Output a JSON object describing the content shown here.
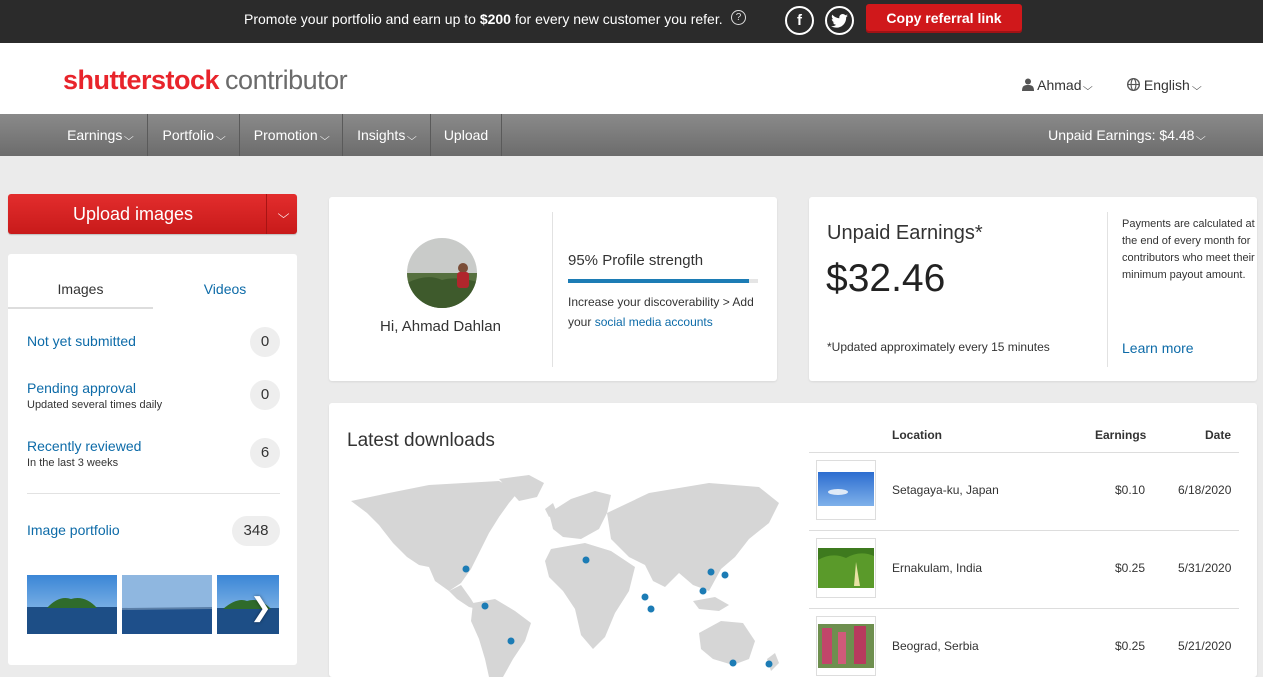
{
  "promo": {
    "text_before": "Promote your portfolio and earn up to ",
    "amount": "$200",
    "text_after": " for every new customer you refer.",
    "help_icon": "?",
    "facebook_icon": "f",
    "twitter_icon": "t",
    "cta": "Copy referral link",
    "cta_color": "#d0181b"
  },
  "header": {
    "logo_brand": "shutterstock",
    "logo_sub": "contributor",
    "user": "Ahmad",
    "language": "English"
  },
  "nav": {
    "items": [
      "Earnings",
      "Portfolio",
      "Promotion",
      "Insights",
      "Upload"
    ],
    "unpaid": "Unpaid Earnings: $4.48"
  },
  "upload_button": "Upload images",
  "tabs": {
    "images": "Images",
    "videos": "Videos"
  },
  "stats": [
    {
      "label": "Not yet submitted",
      "sub": "",
      "count": "0"
    },
    {
      "label": "Pending approval",
      "sub": "Updated several times daily",
      "count": "0"
    },
    {
      "label": "Recently reviewed",
      "sub": "In the last 3 weeks",
      "count": "6"
    }
  ],
  "portfolio": {
    "label": "Image portfolio",
    "count": "348"
  },
  "profile": {
    "greeting": "Hi, Ahmad Dahlan",
    "strength_label": "95% Profile strength",
    "strength_value": 0.95,
    "discover_text": "Increase your discoverability > Add your ",
    "discover_link": "social media accounts"
  },
  "earnings": {
    "title": "Unpaid Earnings*",
    "amount": "$32.46",
    "note": "*Updated approximately every 15 minutes",
    "info": "Payments are calculated at the end of every month for contributors who meet their minimum payout amount.",
    "learn_more": "Learn more"
  },
  "downloads": {
    "title": "Latest downloads",
    "columns": {
      "location": "Location",
      "earnings": "Earnings",
      "date": "Date"
    },
    "rows": [
      {
        "location": "Setagaya-ku, Japan",
        "earnings": "$0.10",
        "date": "6/18/2020"
      },
      {
        "location": "Ernakulam, India",
        "earnings": "$0.25",
        "date": "5/31/2020"
      },
      {
        "location": "Beograd, Serbia",
        "earnings": "$0.25",
        "date": "5/21/2020"
      }
    ]
  },
  "colors": {
    "accent": "#0d6ba8",
    "brand_red": "#e8242b",
    "map_dot": "#1c7cb5"
  }
}
